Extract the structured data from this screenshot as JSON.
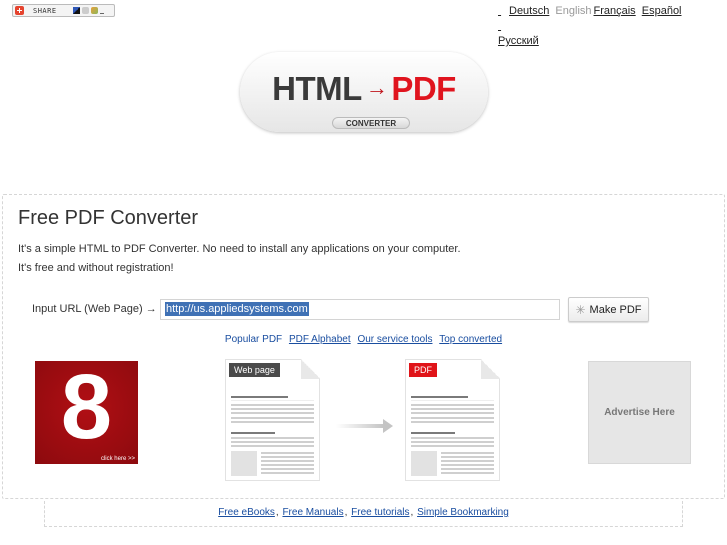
{
  "share": {
    "label": "SHARE",
    "icons": [
      "plus-icon",
      "delicious-icon",
      "digg-icon",
      "windows-live-icon",
      "more-icon"
    ]
  },
  "languages": {
    "items": [
      {
        "label": "Deutsch",
        "active": false
      },
      {
        "label": "English",
        "active": true
      },
      {
        "label": "Français",
        "active": false
      },
      {
        "label": "Español",
        "active": false
      },
      {
        "label": "Русский",
        "active": false
      }
    ]
  },
  "logo": {
    "left": "HTML",
    "arrow": "→",
    "right": "PDF",
    "sub": "CONVERTER"
  },
  "main": {
    "title": "Free PDF Converter",
    "desc_line1": "It's a simple HTML to PDF Converter. No need to install any applications on your computer.",
    "desc_line2": "It's free and without registration!",
    "url_label": "Input URL (Web Page) →",
    "url_value": "http://us.appliedsystems.com",
    "make_button": "Make PDF",
    "links": [
      "Popular PDF",
      "PDF Alphabet",
      "Our service tools",
      "Top converted"
    ]
  },
  "ads": {
    "left_number": "8",
    "left_cta": "click here >>",
    "right": "Advertise Here"
  },
  "illustration": {
    "source_tag": "Web page",
    "target_tag": "PDF"
  },
  "footer": {
    "links": [
      "Free eBooks",
      "Free Manuals",
      "Free tutorials",
      "Simple Bookmarking"
    ]
  },
  "colors": {
    "accent_red": "#e01419",
    "link_blue": "#1a4ea0",
    "selection_blue": "#3f71b5"
  }
}
